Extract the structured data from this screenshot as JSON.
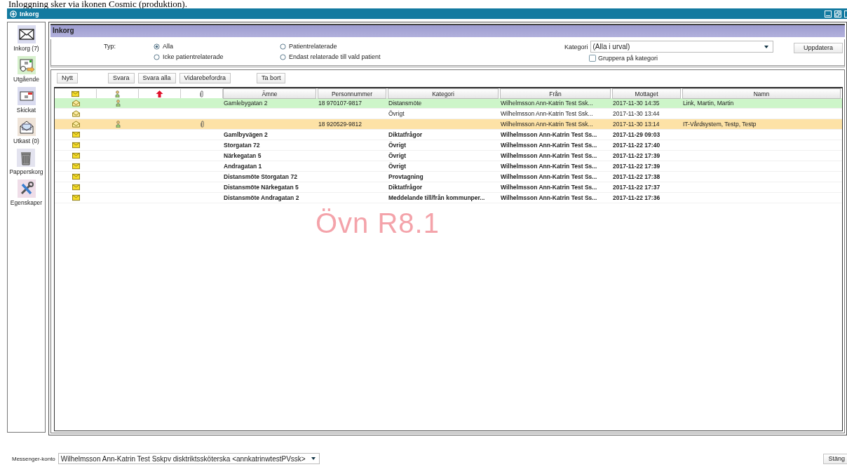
{
  "doc_text": "Inloggning sker via ikonen Cosmic (produktion).",
  "window": {
    "title": "Inkorg"
  },
  "sidebar": {
    "items": [
      {
        "label": "Inkorg (7)",
        "kind": "inbox"
      },
      {
        "label": "Utgående",
        "kind": "outbox"
      },
      {
        "label": "Skickat",
        "kind": "sent"
      },
      {
        "label": "Utkast (0)",
        "kind": "drafts"
      },
      {
        "label": "Papperskorg",
        "kind": "trash"
      },
      {
        "label": "Egenskaper",
        "kind": "settings"
      }
    ]
  },
  "panel": {
    "title": "Inkorg"
  },
  "filters": {
    "type_label": "Typ:",
    "radios": [
      {
        "label": "Alla",
        "selected": true
      },
      {
        "label": "Patientrelaterade",
        "selected": false
      },
      {
        "label": "Icke patientrelaterade",
        "selected": false
      },
      {
        "label": "Endast relaterade till vald patient",
        "selected": false
      }
    ],
    "category_label": "Kategori",
    "category_value": "(Alla i urval)",
    "group_checkbox": {
      "label": "Gruppera på kategori",
      "checked": false
    },
    "update_button": "Uppdatera"
  },
  "toolbar": [
    "Nytt",
    "Svara",
    "Svara alla",
    "Vidarebefordra",
    "Ta bort"
  ],
  "table": {
    "columns": [
      "Ämne",
      "Personnummer",
      "Kategori",
      "Från",
      "Mottaget",
      "Namn"
    ],
    "rows": [
      {
        "color": "#cdf5c9",
        "read": true,
        "patient": true,
        "attachment": false,
        "cells": [
          "Gamlebygatan 2",
          "18 970107-9817",
          "Distansmöte",
          "Wilhelmsson Ann-Katrin Test Ssk...",
          "2017-11-30 14:35",
          "Link, Martin, Martin"
        ]
      },
      {
        "color": "#ffffff",
        "read": true,
        "patient": false,
        "attachment": false,
        "cells": [
          "",
          "",
          "Övrigt",
          "Wilhelmsson Ann-Katrin Test Ssk...",
          "2017-11-30 13:44",
          ""
        ]
      },
      {
        "color": "#fde2a6",
        "read": true,
        "patient": true,
        "attachment": true,
        "cells": [
          "",
          "18 920529-9812",
          "",
          "Wilhelmsson Ann-Katrin Test Ssk...",
          "2017-11-30 13:14",
          "IT-Vårdsystem, Testp, Testp"
        ]
      },
      {
        "color": "#ffffff",
        "read": false,
        "patient": false,
        "attachment": false,
        "cells": [
          "Gamlbyvägen 2",
          "",
          "Diktatfrågor",
          "Wilhelmsson Ann-Katrin Test Ss...",
          "2017-11-29 09:03",
          ""
        ]
      },
      {
        "color": "#ffffff",
        "read": false,
        "patient": false,
        "attachment": false,
        "cells": [
          "Storgatan 72",
          "",
          "Övrigt",
          "Wilhelmsson Ann-Katrin Test Ss...",
          "2017-11-22 17:40",
          ""
        ]
      },
      {
        "color": "#ffffff",
        "read": false,
        "patient": false,
        "attachment": false,
        "cells": [
          "Närkegatan 5",
          "",
          "Övrigt",
          "Wilhelmsson Ann-Katrin Test Ss...",
          "2017-11-22 17:39",
          ""
        ]
      },
      {
        "color": "#ffffff",
        "read": false,
        "patient": false,
        "attachment": false,
        "cells": [
          "Andragatan 1",
          "",
          "Övrigt",
          "Wilhelmsson Ann-Katrin Test Ss...",
          "2017-11-22 17:39",
          ""
        ]
      },
      {
        "color": "#ffffff",
        "read": false,
        "patient": false,
        "attachment": false,
        "cells": [
          "Distansmöte Storgatan 72",
          "",
          "Provtagning",
          "Wilhelmsson Ann-Katrin Test Ss...",
          "2017-11-22 17:38",
          ""
        ]
      },
      {
        "color": "#ffffff",
        "read": false,
        "patient": false,
        "attachment": false,
        "cells": [
          "Distansmöte Närkegatan 5",
          "",
          "Diktatfrågor",
          "Wilhelmsson Ann-Katrin Test Ss...",
          "2017-11-22 17:37",
          ""
        ]
      },
      {
        "color": "#ffffff",
        "read": false,
        "patient": false,
        "attachment": false,
        "cells": [
          "Distansmöte Andragatan 2",
          "",
          "Meddelande till/från kommunper...",
          "Wilhelmsson Ann-Katrin Test Ss...",
          "2017-11-22 17:36",
          ""
        ]
      }
    ]
  },
  "environment_label": "Övn R8.1",
  "footer": {
    "account_label": "Messenger-konto",
    "account_value": "Wilhelmsson Ann-Katrin Test Sskpv disktriktssköterska <annkatrinwtestPVssk>",
    "close_button": "Stäng"
  }
}
